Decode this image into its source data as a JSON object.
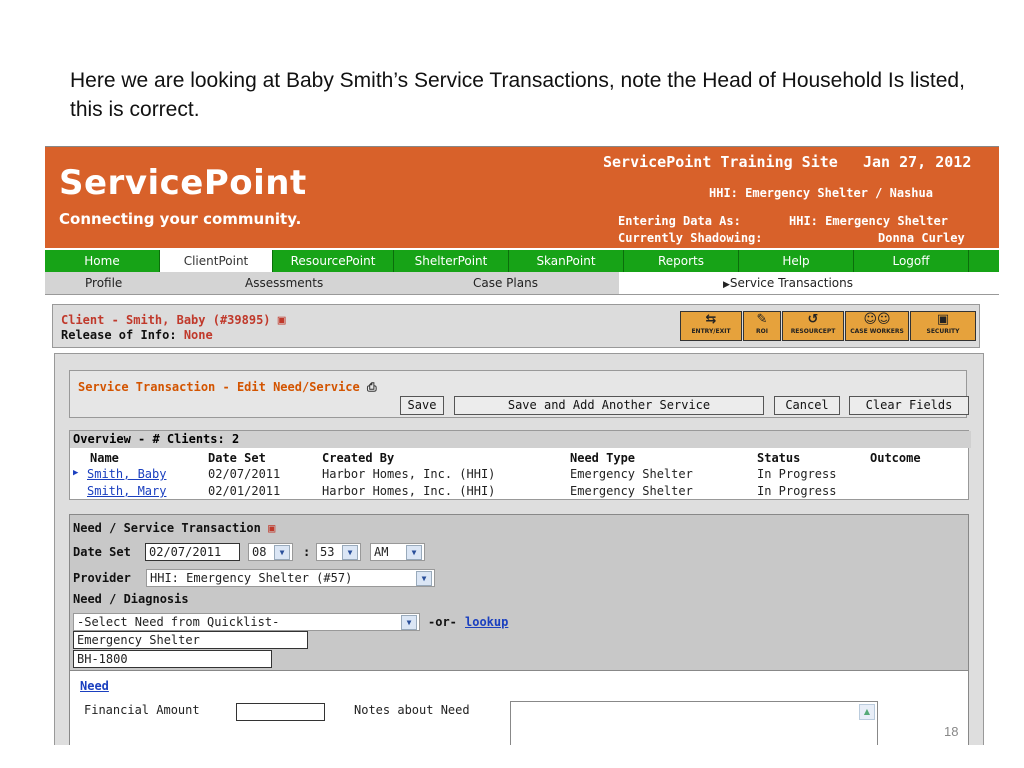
{
  "caption": "Here we are looking at Baby Smith’s Service Transactions, note the Head of Household Is listed, this is correct.",
  "header": {
    "logo_text": "ServicePoint",
    "tagline": "Connecting your community.",
    "site": "ServicePoint Training Site",
    "date": "Jan 27, 2012",
    "agency": "HHI: Emergency Shelter / Nashua",
    "entering_label": "Entering Data As:",
    "entering_value": "HHI: Emergency Shelter",
    "shadow_label": "Currently Shadowing:",
    "shadow_value": "Donna Curley"
  },
  "nav": [
    "Home",
    "ClientPoint",
    "ResourcePoint",
    "ShelterPoint",
    "SkanPoint",
    "Reports",
    "Help",
    "Logoff"
  ],
  "subnav": [
    "Profile",
    "Assessments",
    "Case Plans",
    "Service Transactions"
  ],
  "client": {
    "name": "Client - Smith, Baby (#39895)",
    "release_label": "Release of Info:",
    "release_value": "None",
    "tools": [
      "ENTRY/EXIT",
      "ROI",
      "RESOURCEPT",
      "CASE WORKERS",
      "SECURITY"
    ]
  },
  "transaction": {
    "title": "Service Transaction - Edit Need/Service",
    "buttons": {
      "save": "Save",
      "save_add": "Save and Add Another Service",
      "cancel": "Cancel",
      "clear": "Clear Fields"
    }
  },
  "overview": {
    "title": "Overview - # Clients: 2",
    "columns": [
      "Name",
      "Date Set",
      "Created By",
      "Need Type",
      "Status",
      "Outcome"
    ],
    "rows": [
      [
        "Smith, Baby",
        "02/07/2011",
        "Harbor Homes, Inc. (HHI)",
        "Emergency Shelter",
        "In Progress",
        ""
      ],
      [
        "Smith, Mary",
        "02/01/2011",
        "Harbor Homes, Inc. (HHI)",
        "Emergency Shelter",
        "In Progress",
        ""
      ]
    ]
  },
  "need_service": {
    "title": "Need / Service Transaction",
    "date_label": "Date Set",
    "date_value": "02/07/2011",
    "hour": "08",
    "colon": ":",
    "minute": "53",
    "ampm": "AM",
    "provider_label": "Provider",
    "provider_value": "HHI: Emergency Shelter (#57)",
    "diagnosis_label": "Need / Diagnosis",
    "quicklist": "-Select Need from Quicklist-",
    "or_text": "-or-",
    "lookup": "lookup",
    "need_name": "Emergency Shelter",
    "need_code": "BH-1800"
  },
  "need_section": {
    "title": "Need",
    "financial_label": "Financial Amount",
    "notes_label": "Notes about Need"
  },
  "page_number": "18",
  "colors": {
    "header": "#d8612a",
    "nav": "#17a317",
    "accent": "#c0392b",
    "link": "#1a3fbf"
  }
}
